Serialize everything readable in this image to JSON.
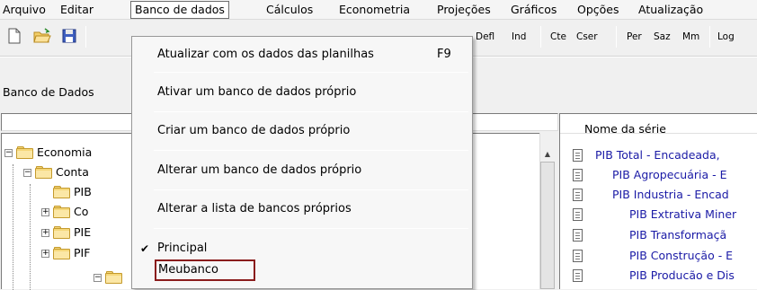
{
  "menubar": {
    "items": [
      {
        "label": "Arquivo",
        "active": false
      },
      {
        "label": "Editar",
        "active": false
      },
      {
        "label": "Banco de dados",
        "active": true
      },
      {
        "label": "Cálculos",
        "active": false
      },
      {
        "label": "Econometria",
        "active": false
      },
      {
        "label": "Projeções",
        "active": false
      },
      {
        "label": "Gráficos",
        "active": false
      },
      {
        "label": "Opções",
        "active": false
      },
      {
        "label": "Atualização",
        "active": false
      }
    ]
  },
  "toolbar": {
    "icons": [
      "new-file-icon",
      "open-folder-icon",
      "save-disk-icon"
    ],
    "buttons": [
      "Defl",
      "Ind",
      "Cte",
      "Cser",
      "Per",
      "Saz",
      "Mm",
      "Log"
    ]
  },
  "left_panel": {
    "title": "Banco de Dados",
    "search_value": "",
    "tree": [
      {
        "label": "Economia",
        "expander": "−"
      },
      {
        "label": "Conta",
        "expander": "−"
      },
      {
        "label": "PIB",
        "expander": ""
      },
      {
        "label": "Co",
        "expander": "+"
      },
      {
        "label": "PIE",
        "expander": "+"
      },
      {
        "label": "PIF",
        "expander": "+"
      },
      {
        "label": "",
        "expander": "−"
      }
    ]
  },
  "right_panel": {
    "header": "Nome da série",
    "series": [
      "PIB Total - Encadeada,",
      "PIB Agropecuária - E",
      "PIB Industria - Encad",
      "PIB Extrativa Miner",
      "PIB Transformaçã",
      "PIB Construção - E",
      "PIB Producão e Dis"
    ]
  },
  "dropdown": {
    "items": [
      {
        "label": "Atualizar com os dados das planilhas",
        "shortcut": "F9",
        "checked": false
      },
      {
        "label": "Ativar um banco de dados próprio",
        "shortcut": "",
        "checked": false
      },
      {
        "label": "Criar um banco de dados próprio",
        "shortcut": "",
        "checked": false
      },
      {
        "label": "Alterar um banco de dados próprio",
        "shortcut": "",
        "checked": false
      },
      {
        "label": "Alterar a lista de bancos próprios",
        "shortcut": "",
        "checked": false
      },
      {
        "label": "Principal",
        "shortcut": "",
        "checked": true
      },
      {
        "label": "Meubanco",
        "shortcut": "",
        "checked": false,
        "highlighted": true
      }
    ],
    "check_glyph": "✔"
  },
  "colors": {
    "series_text": "#1a1aa6",
    "highlight_border": "#8a1c1c",
    "folder": "#f5d77a"
  }
}
